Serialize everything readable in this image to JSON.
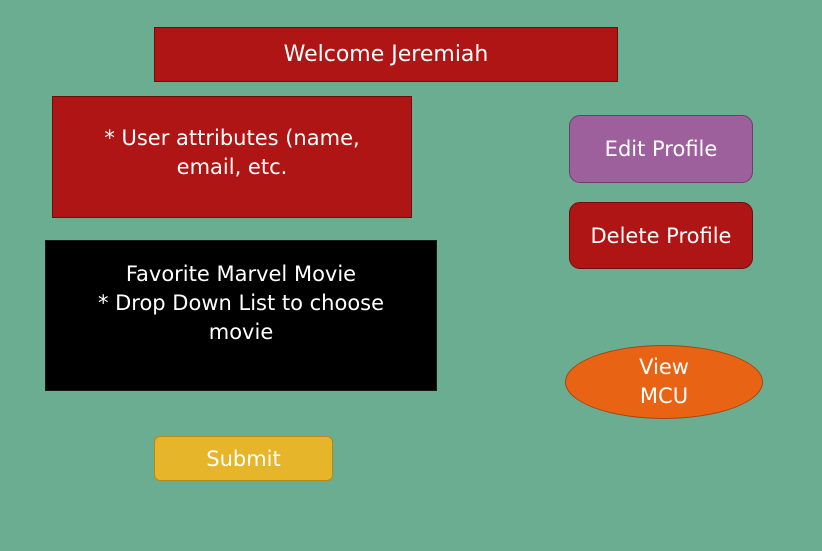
{
  "header": {
    "welcome_text": "Welcome Jeremiah"
  },
  "profile": {
    "attributes_text": "* User attributes (name, email, etc."
  },
  "favorite_movie": {
    "title": "Favorite Marvel Movie",
    "description": "* Drop Down List to choose movie"
  },
  "actions": {
    "edit_profile_label": "Edit Profile",
    "delete_profile_label": "Delete Profile",
    "view_mcu_label": "View MCU",
    "submit_label": "Submit"
  },
  "colors": {
    "background": "#6aad91",
    "red": "#b01515",
    "purple": "#9e5f9d",
    "orange": "#e86414",
    "yellow": "#e6b52a",
    "black": "#000000"
  }
}
